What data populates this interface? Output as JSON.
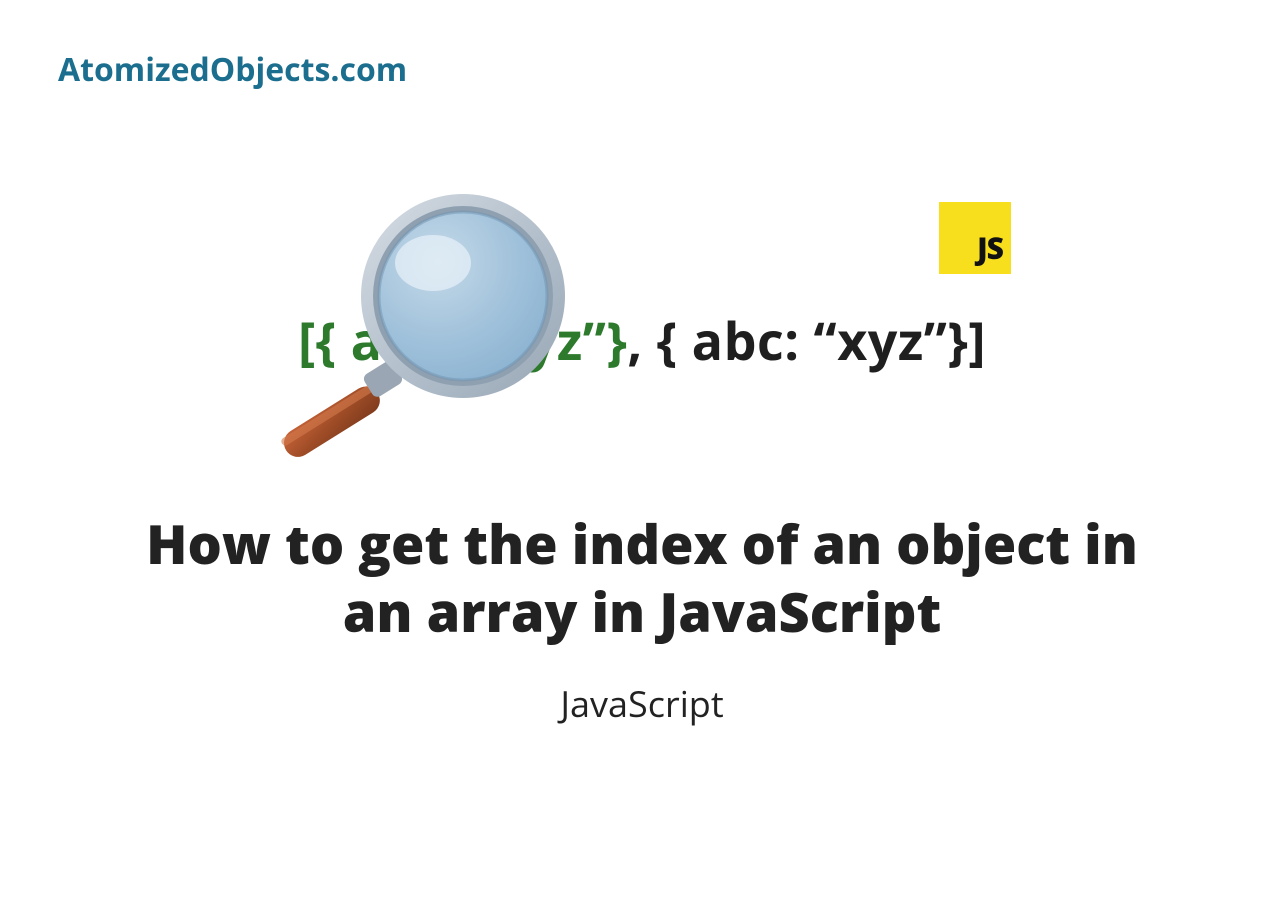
{
  "site": {
    "name": "AtomizedObjects.com"
  },
  "badge": {
    "label": "JS"
  },
  "code": {
    "bracket_open": "[",
    "first_obj": "{ abc: “xyz”}",
    "separator": ", ",
    "second_obj": "{ abc: “xyz”}",
    "bracket_close": "]"
  },
  "article": {
    "title": "How to get the index of an object in an array in JavaScript",
    "category": "JavaScript"
  },
  "colors": {
    "brand": "#1b6e8e",
    "js_yellow": "#f7df1e",
    "code_green": "#2d7a2d",
    "text_dark": "#222222"
  }
}
